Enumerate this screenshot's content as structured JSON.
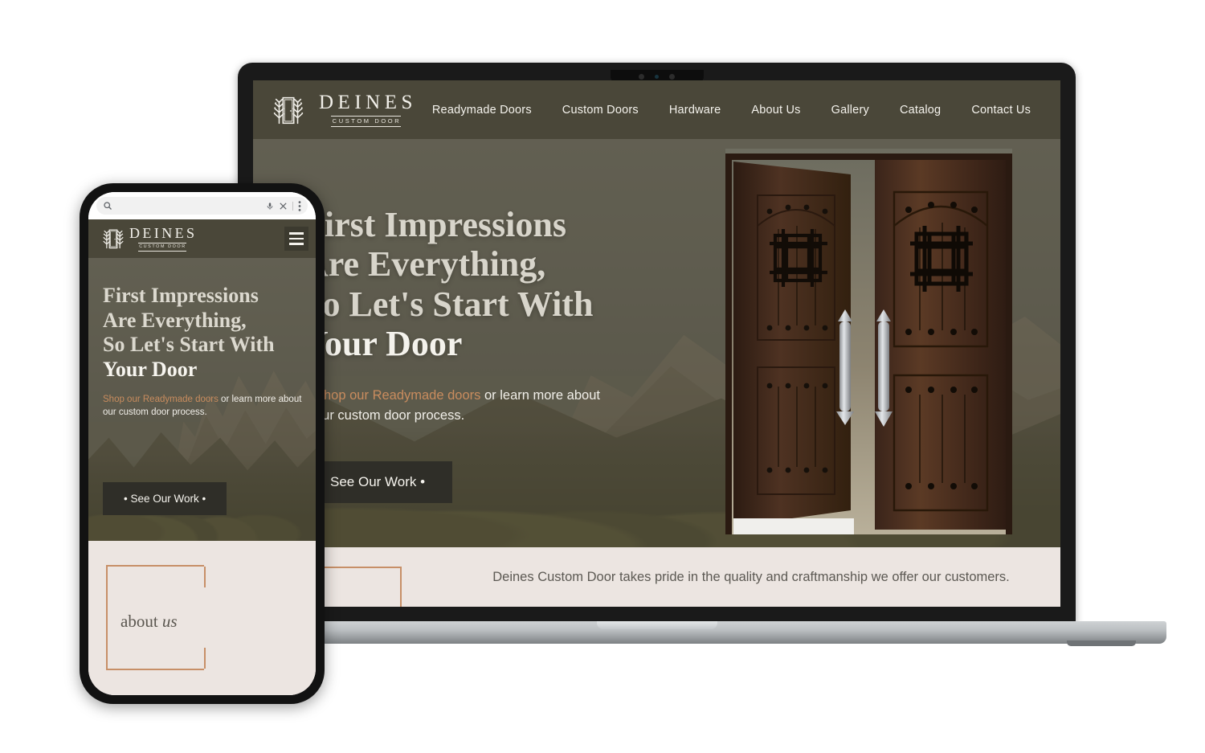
{
  "brand": {
    "name": "DEINES",
    "tagline": "CUSTOM DOOR",
    "logo_icon": "door-with-trees-icon",
    "accent_color": "#c98c5e",
    "header_color": "#4a4739",
    "cream_color": "#ece5e1"
  },
  "desktop": {
    "nav": [
      {
        "label": "Readymade Doors"
      },
      {
        "label": "Custom Doors"
      },
      {
        "label": "Hardware"
      },
      {
        "label": "About Us"
      },
      {
        "label": "Gallery"
      },
      {
        "label": "Catalog"
      },
      {
        "label": "Contact Us"
      }
    ],
    "hero": {
      "title_line1": "First Impressions",
      "title_line2": "Are Everything,",
      "title_line3": "So Let's Start With",
      "title_line4": "Your Door",
      "sub_prefix": "Shop our ",
      "sub_link": "Readymade doors",
      "sub_suffix": " or learn more about our custom door process.",
      "cta_label": "See Our Work •",
      "image_alt": "double-rustic-wood-door-photo"
    },
    "about": {
      "tagline": "Deines Custom  Door takes pride in the quality and craftmanship we offer our customers."
    }
  },
  "phone": {
    "browser": {
      "search_value": "",
      "search_placeholder": "",
      "icons": [
        "search-icon",
        "microphone-icon",
        "close-icon",
        "overflow-menu-icon"
      ]
    },
    "menu_icon": "hamburger-menu-icon",
    "hero": {
      "title_line1": "First Impressions",
      "title_line2": "Are Everything,",
      "title_line3": "So Let's Start With",
      "title_line4": "Your Door",
      "sub_prefix": "Shop our ",
      "sub_link": "Readymade doors",
      "sub_suffix": " or learn more about our custom door process.",
      "cta_label": "• See Our Work •"
    },
    "about": {
      "label_main": "about ",
      "label_italic": "us"
    }
  }
}
